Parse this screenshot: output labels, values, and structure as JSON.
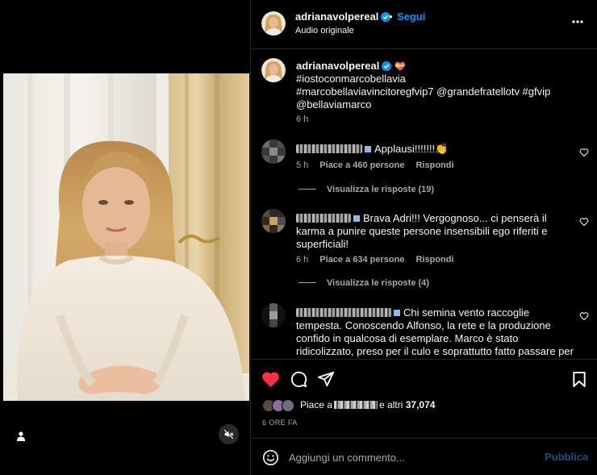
{
  "post": {
    "username": "adrianavolpereal",
    "follow_label": "Segui",
    "separator": "•",
    "audio_label": "Audio originale",
    "more_icon": "more-horizontal-icon"
  },
  "caption": {
    "username": "adrianavolpereal",
    "emoji": "💝",
    "lines": [
      "#iostoconmarcobellavia",
      "#marcobellaviavincitoregfvip7 @grandefratellotv #gfvip",
      "@bellaviamarco"
    ],
    "time": "6 h"
  },
  "comments": [
    {
      "text": "Applausi!!!!!!!👏",
      "time": "5 h",
      "likes": "Piace a 460 persone",
      "reply": "Rispondi",
      "view_replies": "Visualizza le risposte (19)"
    },
    {
      "text_line1": "Brava Adri!!! Vergognoso... ci penserà il",
      "text_line2": "karma a punire queste persone insensibili ego riferiti e",
      "text_line3": "superficiali!",
      "time": "6 h",
      "likes": "Piace a 634 persone",
      "reply": "Rispondi",
      "view_replies": "Visualizza le risposte (4)"
    },
    {
      "text_line1": "Chi semina vento raccoglie",
      "text_line2": "tempesta. Conoscendo Alfonso, la rete e la produzione",
      "text_line3": "confido in qualcosa di esemplare. Marco è stato",
      "text_line4": "ridicolizzato, preso per il culo e soprattutto fatto passare per"
    }
  ],
  "likes_summary": {
    "prefix": "Piace a",
    "suffix": "e altri",
    "count": "37,074"
  },
  "post_time": "6 ORE FA",
  "composer": {
    "placeholder": "Aggiungi un commento...",
    "publish_label": "Pubblica"
  },
  "colors": {
    "accent": "#0095f6",
    "like_red": "#ff3040",
    "muted": "#a8a8a8",
    "divider": "#262626"
  }
}
